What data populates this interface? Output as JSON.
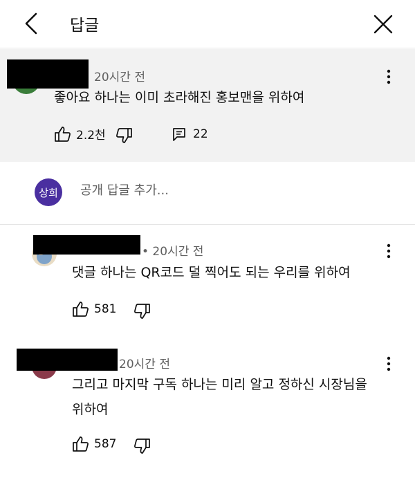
{
  "header": {
    "title": "답글"
  },
  "parent_comment": {
    "time": "20시간 전",
    "text": "좋아요 하나는 이미 초라해진 홍보맨을 위하여",
    "likes": "2.2천",
    "replies": "22"
  },
  "add_reply": {
    "avatar_text": "상희",
    "placeholder": "공개 답글 추가..."
  },
  "replies": [
    {
      "time": "• 20시간 전",
      "text_lines": [
        "댓글 하나는 QR코드 덜 찍어도 되는 우리를 위하여"
      ],
      "likes": "581"
    },
    {
      "time": "20시간 전",
      "text_lines": [
        "그리고 마지막 구독 하나는 미리 알고 정하신 시장님을",
        "위하여"
      ],
      "likes": "587"
    }
  ],
  "colors": {
    "add_reply_avatar": "#4a2fa0",
    "parent_background": "#f2f2f2"
  }
}
